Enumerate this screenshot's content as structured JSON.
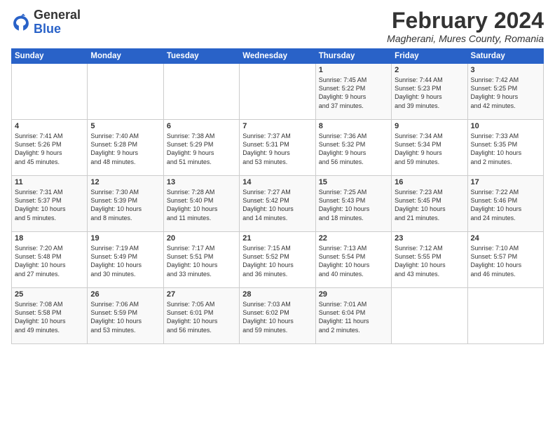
{
  "logo": {
    "general": "General",
    "blue": "Blue"
  },
  "header": {
    "month": "February 2024",
    "location": "Magherani, Mures County, Romania"
  },
  "days_of_week": [
    "Sunday",
    "Monday",
    "Tuesday",
    "Wednesday",
    "Thursday",
    "Friday",
    "Saturday"
  ],
  "weeks": [
    [
      {
        "day": "",
        "info": ""
      },
      {
        "day": "",
        "info": ""
      },
      {
        "day": "",
        "info": ""
      },
      {
        "day": "",
        "info": ""
      },
      {
        "day": "1",
        "info": "Sunrise: 7:45 AM\nSunset: 5:22 PM\nDaylight: 9 hours\nand 37 minutes."
      },
      {
        "day": "2",
        "info": "Sunrise: 7:44 AM\nSunset: 5:23 PM\nDaylight: 9 hours\nand 39 minutes."
      },
      {
        "day": "3",
        "info": "Sunrise: 7:42 AM\nSunset: 5:25 PM\nDaylight: 9 hours\nand 42 minutes."
      }
    ],
    [
      {
        "day": "4",
        "info": "Sunrise: 7:41 AM\nSunset: 5:26 PM\nDaylight: 9 hours\nand 45 minutes."
      },
      {
        "day": "5",
        "info": "Sunrise: 7:40 AM\nSunset: 5:28 PM\nDaylight: 9 hours\nand 48 minutes."
      },
      {
        "day": "6",
        "info": "Sunrise: 7:38 AM\nSunset: 5:29 PM\nDaylight: 9 hours\nand 51 minutes."
      },
      {
        "day": "7",
        "info": "Sunrise: 7:37 AM\nSunset: 5:31 PM\nDaylight: 9 hours\nand 53 minutes."
      },
      {
        "day": "8",
        "info": "Sunrise: 7:36 AM\nSunset: 5:32 PM\nDaylight: 9 hours\nand 56 minutes."
      },
      {
        "day": "9",
        "info": "Sunrise: 7:34 AM\nSunset: 5:34 PM\nDaylight: 9 hours\nand 59 minutes."
      },
      {
        "day": "10",
        "info": "Sunrise: 7:33 AM\nSunset: 5:35 PM\nDaylight: 10 hours\nand 2 minutes."
      }
    ],
    [
      {
        "day": "11",
        "info": "Sunrise: 7:31 AM\nSunset: 5:37 PM\nDaylight: 10 hours\nand 5 minutes."
      },
      {
        "day": "12",
        "info": "Sunrise: 7:30 AM\nSunset: 5:39 PM\nDaylight: 10 hours\nand 8 minutes."
      },
      {
        "day": "13",
        "info": "Sunrise: 7:28 AM\nSunset: 5:40 PM\nDaylight: 10 hours\nand 11 minutes."
      },
      {
        "day": "14",
        "info": "Sunrise: 7:27 AM\nSunset: 5:42 PM\nDaylight: 10 hours\nand 14 minutes."
      },
      {
        "day": "15",
        "info": "Sunrise: 7:25 AM\nSunset: 5:43 PM\nDaylight: 10 hours\nand 18 minutes."
      },
      {
        "day": "16",
        "info": "Sunrise: 7:23 AM\nSunset: 5:45 PM\nDaylight: 10 hours\nand 21 minutes."
      },
      {
        "day": "17",
        "info": "Sunrise: 7:22 AM\nSunset: 5:46 PM\nDaylight: 10 hours\nand 24 minutes."
      }
    ],
    [
      {
        "day": "18",
        "info": "Sunrise: 7:20 AM\nSunset: 5:48 PM\nDaylight: 10 hours\nand 27 minutes."
      },
      {
        "day": "19",
        "info": "Sunrise: 7:19 AM\nSunset: 5:49 PM\nDaylight: 10 hours\nand 30 minutes."
      },
      {
        "day": "20",
        "info": "Sunrise: 7:17 AM\nSunset: 5:51 PM\nDaylight: 10 hours\nand 33 minutes."
      },
      {
        "day": "21",
        "info": "Sunrise: 7:15 AM\nSunset: 5:52 PM\nDaylight: 10 hours\nand 36 minutes."
      },
      {
        "day": "22",
        "info": "Sunrise: 7:13 AM\nSunset: 5:54 PM\nDaylight: 10 hours\nand 40 minutes."
      },
      {
        "day": "23",
        "info": "Sunrise: 7:12 AM\nSunset: 5:55 PM\nDaylight: 10 hours\nand 43 minutes."
      },
      {
        "day": "24",
        "info": "Sunrise: 7:10 AM\nSunset: 5:57 PM\nDaylight: 10 hours\nand 46 minutes."
      }
    ],
    [
      {
        "day": "25",
        "info": "Sunrise: 7:08 AM\nSunset: 5:58 PM\nDaylight: 10 hours\nand 49 minutes."
      },
      {
        "day": "26",
        "info": "Sunrise: 7:06 AM\nSunset: 5:59 PM\nDaylight: 10 hours\nand 53 minutes."
      },
      {
        "day": "27",
        "info": "Sunrise: 7:05 AM\nSunset: 6:01 PM\nDaylight: 10 hours\nand 56 minutes."
      },
      {
        "day": "28",
        "info": "Sunrise: 7:03 AM\nSunset: 6:02 PM\nDaylight: 10 hours\nand 59 minutes."
      },
      {
        "day": "29",
        "info": "Sunrise: 7:01 AM\nSunset: 6:04 PM\nDaylight: 11 hours\nand 2 minutes."
      },
      {
        "day": "",
        "info": ""
      },
      {
        "day": "",
        "info": ""
      }
    ]
  ]
}
